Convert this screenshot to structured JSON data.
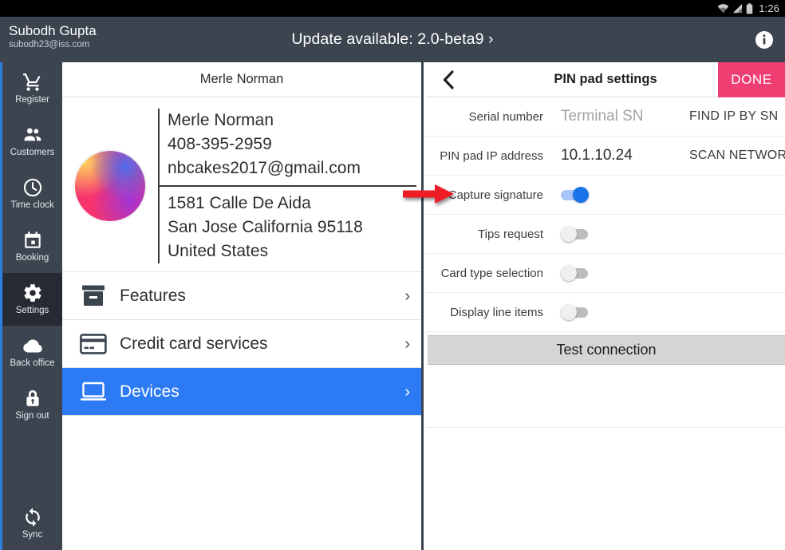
{
  "statusbar": {
    "time": "1:26",
    "wifi_icon": "wifi-icon",
    "signal_icon": "signal-icon",
    "battery_icon": "battery-icon"
  },
  "appbar": {
    "account_name": "Subodh Gupta",
    "account_email": "subodh23@iss.com",
    "update_message": "Update available: 2.0-beta9 ›",
    "info_icon": "info-icon"
  },
  "rail": {
    "items": [
      {
        "label": "Register",
        "icon": "shopping-cart-icon",
        "active": false
      },
      {
        "label": "Customers",
        "icon": "people-icon",
        "active": false
      },
      {
        "label": "Time clock",
        "icon": "clock-icon",
        "active": false
      },
      {
        "label": "Booking",
        "icon": "calendar-icon",
        "active": false
      },
      {
        "label": "Settings",
        "icon": "gear-icon",
        "active": true
      },
      {
        "label": "Back office",
        "icon": "cloud-icon",
        "active": false
      },
      {
        "label": "Sign out",
        "icon": "lock-icon",
        "active": false
      }
    ],
    "sync": {
      "label": "Sync",
      "icon": "sync-icon"
    },
    "accent_color": "#2d7fe0",
    "background_color": "#3c4450"
  },
  "middle": {
    "header_title": "Merle Norman",
    "avatar": "business-avatar",
    "contact": [
      "Merle Norman",
      "408-395-2959",
      "nbcakes2017@gmail.com"
    ],
    "address": [
      "1581 Calle De Aida",
      "San Jose California 95118",
      "United States"
    ],
    "menu": [
      {
        "label": "Features",
        "icon": "archive-box-icon",
        "selected": false,
        "chevron": "›"
      },
      {
        "label": "Credit card services",
        "icon": "credit-card-icon",
        "selected": false,
        "chevron": "›"
      },
      {
        "label": "Devices",
        "icon": "laptop-icon",
        "selected": true,
        "chevron": "›"
      }
    ],
    "selected_color": "#2d7bf4"
  },
  "right": {
    "back_icon": "back-chevron-icon",
    "title": "PIN pad settings",
    "done_label": "DONE",
    "done_color": "#ef3f72",
    "fields": [
      {
        "label": "Serial number",
        "value": "Terminal SN",
        "is_placeholder": true,
        "action": "FIND IP BY SN"
      },
      {
        "label": "PIN pad IP address",
        "value": "10.1.10.24",
        "is_placeholder": false,
        "action": "SCAN NETWORK"
      }
    ],
    "toggles": [
      {
        "label": "Capture signature",
        "on": true,
        "annotated": true
      },
      {
        "label": "Tips request",
        "on": false,
        "annotated": false
      },
      {
        "label": "Card type selection",
        "on": false,
        "annotated": false
      },
      {
        "label": "Display line items",
        "on": false,
        "annotated": false
      }
    ],
    "test_button_label": "Test connection",
    "toggle_on_color": "#1a73e8"
  },
  "annotation": {
    "arrow_color": "#ee1c25",
    "points_to": "Capture signature"
  }
}
